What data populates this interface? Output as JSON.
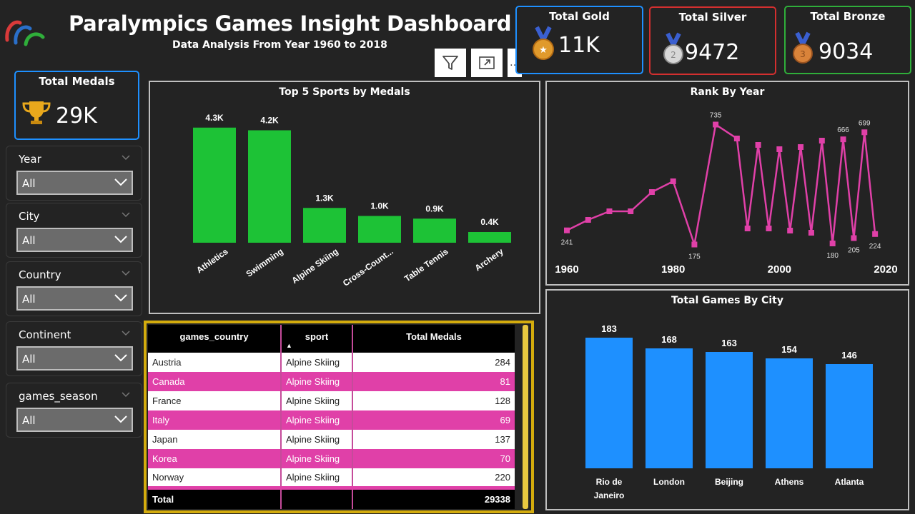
{
  "header": {
    "title": "Paralympics Games Insight Dashboard",
    "subtitle": "Data Analysis From Year 1960 to 2018"
  },
  "kpis": {
    "gold": {
      "label": "Total Gold",
      "value": "11K",
      "color": "#1e90ff"
    },
    "silver": {
      "label": "Total Silver",
      "value": "9472",
      "color": "#d32f2f"
    },
    "bronze": {
      "label": "Total Bronze",
      "value": "9034",
      "color": "#2fae3a"
    },
    "total": {
      "label": "Total Medals",
      "value": "29K",
      "color": "#1e90ff"
    }
  },
  "filters": [
    {
      "label": "Year",
      "value": "All"
    },
    {
      "label": "City",
      "value": "All"
    },
    {
      "label": "Country",
      "value": "All"
    },
    {
      "label": "Continent",
      "value": "All"
    },
    {
      "label": "games_season",
      "value": "All"
    }
  ],
  "toolbar_icons": [
    "filter-icon",
    "focus-mode-icon",
    "more-options-icon"
  ],
  "colors": {
    "green": "#1dc236",
    "pink": "#e040a8",
    "blue": "#1e90ff",
    "gold_border": "#d4ac0d"
  },
  "chart_data": [
    {
      "type": "bar",
      "title": "Top 5 Sports by Medals",
      "categories": [
        "Athletics",
        "Swimming",
        "Alpine Skiing",
        "Cross-Count...",
        "Table Tennis",
        "Archery"
      ],
      "values": [
        4300,
        4200,
        1300,
        1000,
        900,
        400
      ],
      "data_labels": [
        "4.3K",
        "4.2K",
        "1.3K",
        "1.0K",
        "0.9K",
        "0.4K"
      ],
      "ylim": [
        0,
        4800
      ],
      "color": "#1dc236"
    },
    {
      "type": "line",
      "title": "Rank By Year",
      "x": [
        1960,
        1964,
        1968,
        1972,
        1976,
        1980,
        1984,
        1988,
        1992,
        1994,
        1996,
        1998,
        2000,
        2002,
        2004,
        2006,
        2008,
        2010,
        2012,
        2014,
        2016,
        2018
      ],
      "y": [
        241,
        290,
        330,
        330,
        420,
        470,
        175,
        735,
        670,
        250,
        640,
        250,
        620,
        240,
        630,
        230,
        660,
        180,
        666,
        205,
        699,
        224
      ],
      "data_labels": {
        "1960": "241",
        "1984": "175",
        "1988": "735",
        "2010": "180",
        "2012": "666",
        "2014": "205",
        "2016": "699",
        "2018": "224"
      },
      "x_ticks": [
        "1960",
        "1980",
        "2000",
        "2020"
      ],
      "xlim": [
        1960,
        2020
      ],
      "ylim": [
        100,
        800
      ],
      "color": "#e040a8"
    },
    {
      "type": "bar",
      "title": "Total Games By City",
      "categories": [
        "Rio de Janeiro",
        "London",
        "Beijing",
        "Athens",
        "Atlanta"
      ],
      "values": [
        183,
        168,
        163,
        154,
        146
      ],
      "ylim": [
        0,
        200
      ],
      "color": "#1e90ff"
    },
    {
      "type": "table",
      "columns": [
        "games_country",
        "sport",
        "Total Medals"
      ],
      "sort_indicator": "▲",
      "rows": [
        [
          "Austria",
          "Alpine Skiing",
          "284"
        ],
        [
          "Canada",
          "Alpine Skiing",
          "81"
        ],
        [
          "France",
          "Alpine Skiing",
          "128"
        ],
        [
          "Italy",
          "Alpine Skiing",
          "69"
        ],
        [
          "Japan",
          "Alpine Skiing",
          "137"
        ],
        [
          "Korea",
          "Alpine Skiing",
          "70"
        ],
        [
          "Norway",
          "Alpine Skiing",
          "220"
        ]
      ],
      "total": {
        "label": "Total",
        "value": "29338"
      }
    }
  ]
}
